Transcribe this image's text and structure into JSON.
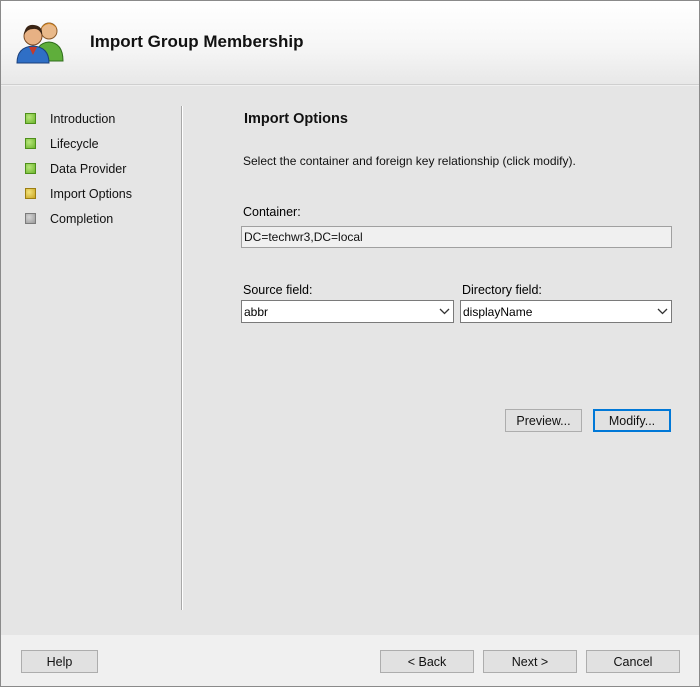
{
  "window": {
    "title": "Import Group Membership",
    "icon": "users-group-icon"
  },
  "steps": [
    {
      "label": "Introduction",
      "status": "complete",
      "color": "#6cb52d"
    },
    {
      "label": "Lifecycle",
      "status": "complete",
      "color": "#6cb52d"
    },
    {
      "label": "Data Provider",
      "status": "complete",
      "color": "#6cb52d"
    },
    {
      "label": "Import Options",
      "status": "current",
      "color": "#c9a424"
    },
    {
      "label": "Completion",
      "status": "pending",
      "color": "#9a9a9a"
    }
  ],
  "main": {
    "section_title": "Import Options",
    "instructions": "Select the container and foreign key relationship (click modify).",
    "container_label": "Container:",
    "container_value": "DC=techwr3,DC=local",
    "source_field": {
      "label": "Source field:",
      "value": "abbr"
    },
    "directory_field": {
      "label": "Directory field:",
      "value": "displayName"
    },
    "preview_button": "Preview...",
    "modify_button": "Modify..."
  },
  "footer": {
    "help": "Help",
    "back": "< Back",
    "next": "Next >",
    "cancel": "Cancel"
  },
  "colors": {
    "default_button_border": "#0078d7"
  }
}
